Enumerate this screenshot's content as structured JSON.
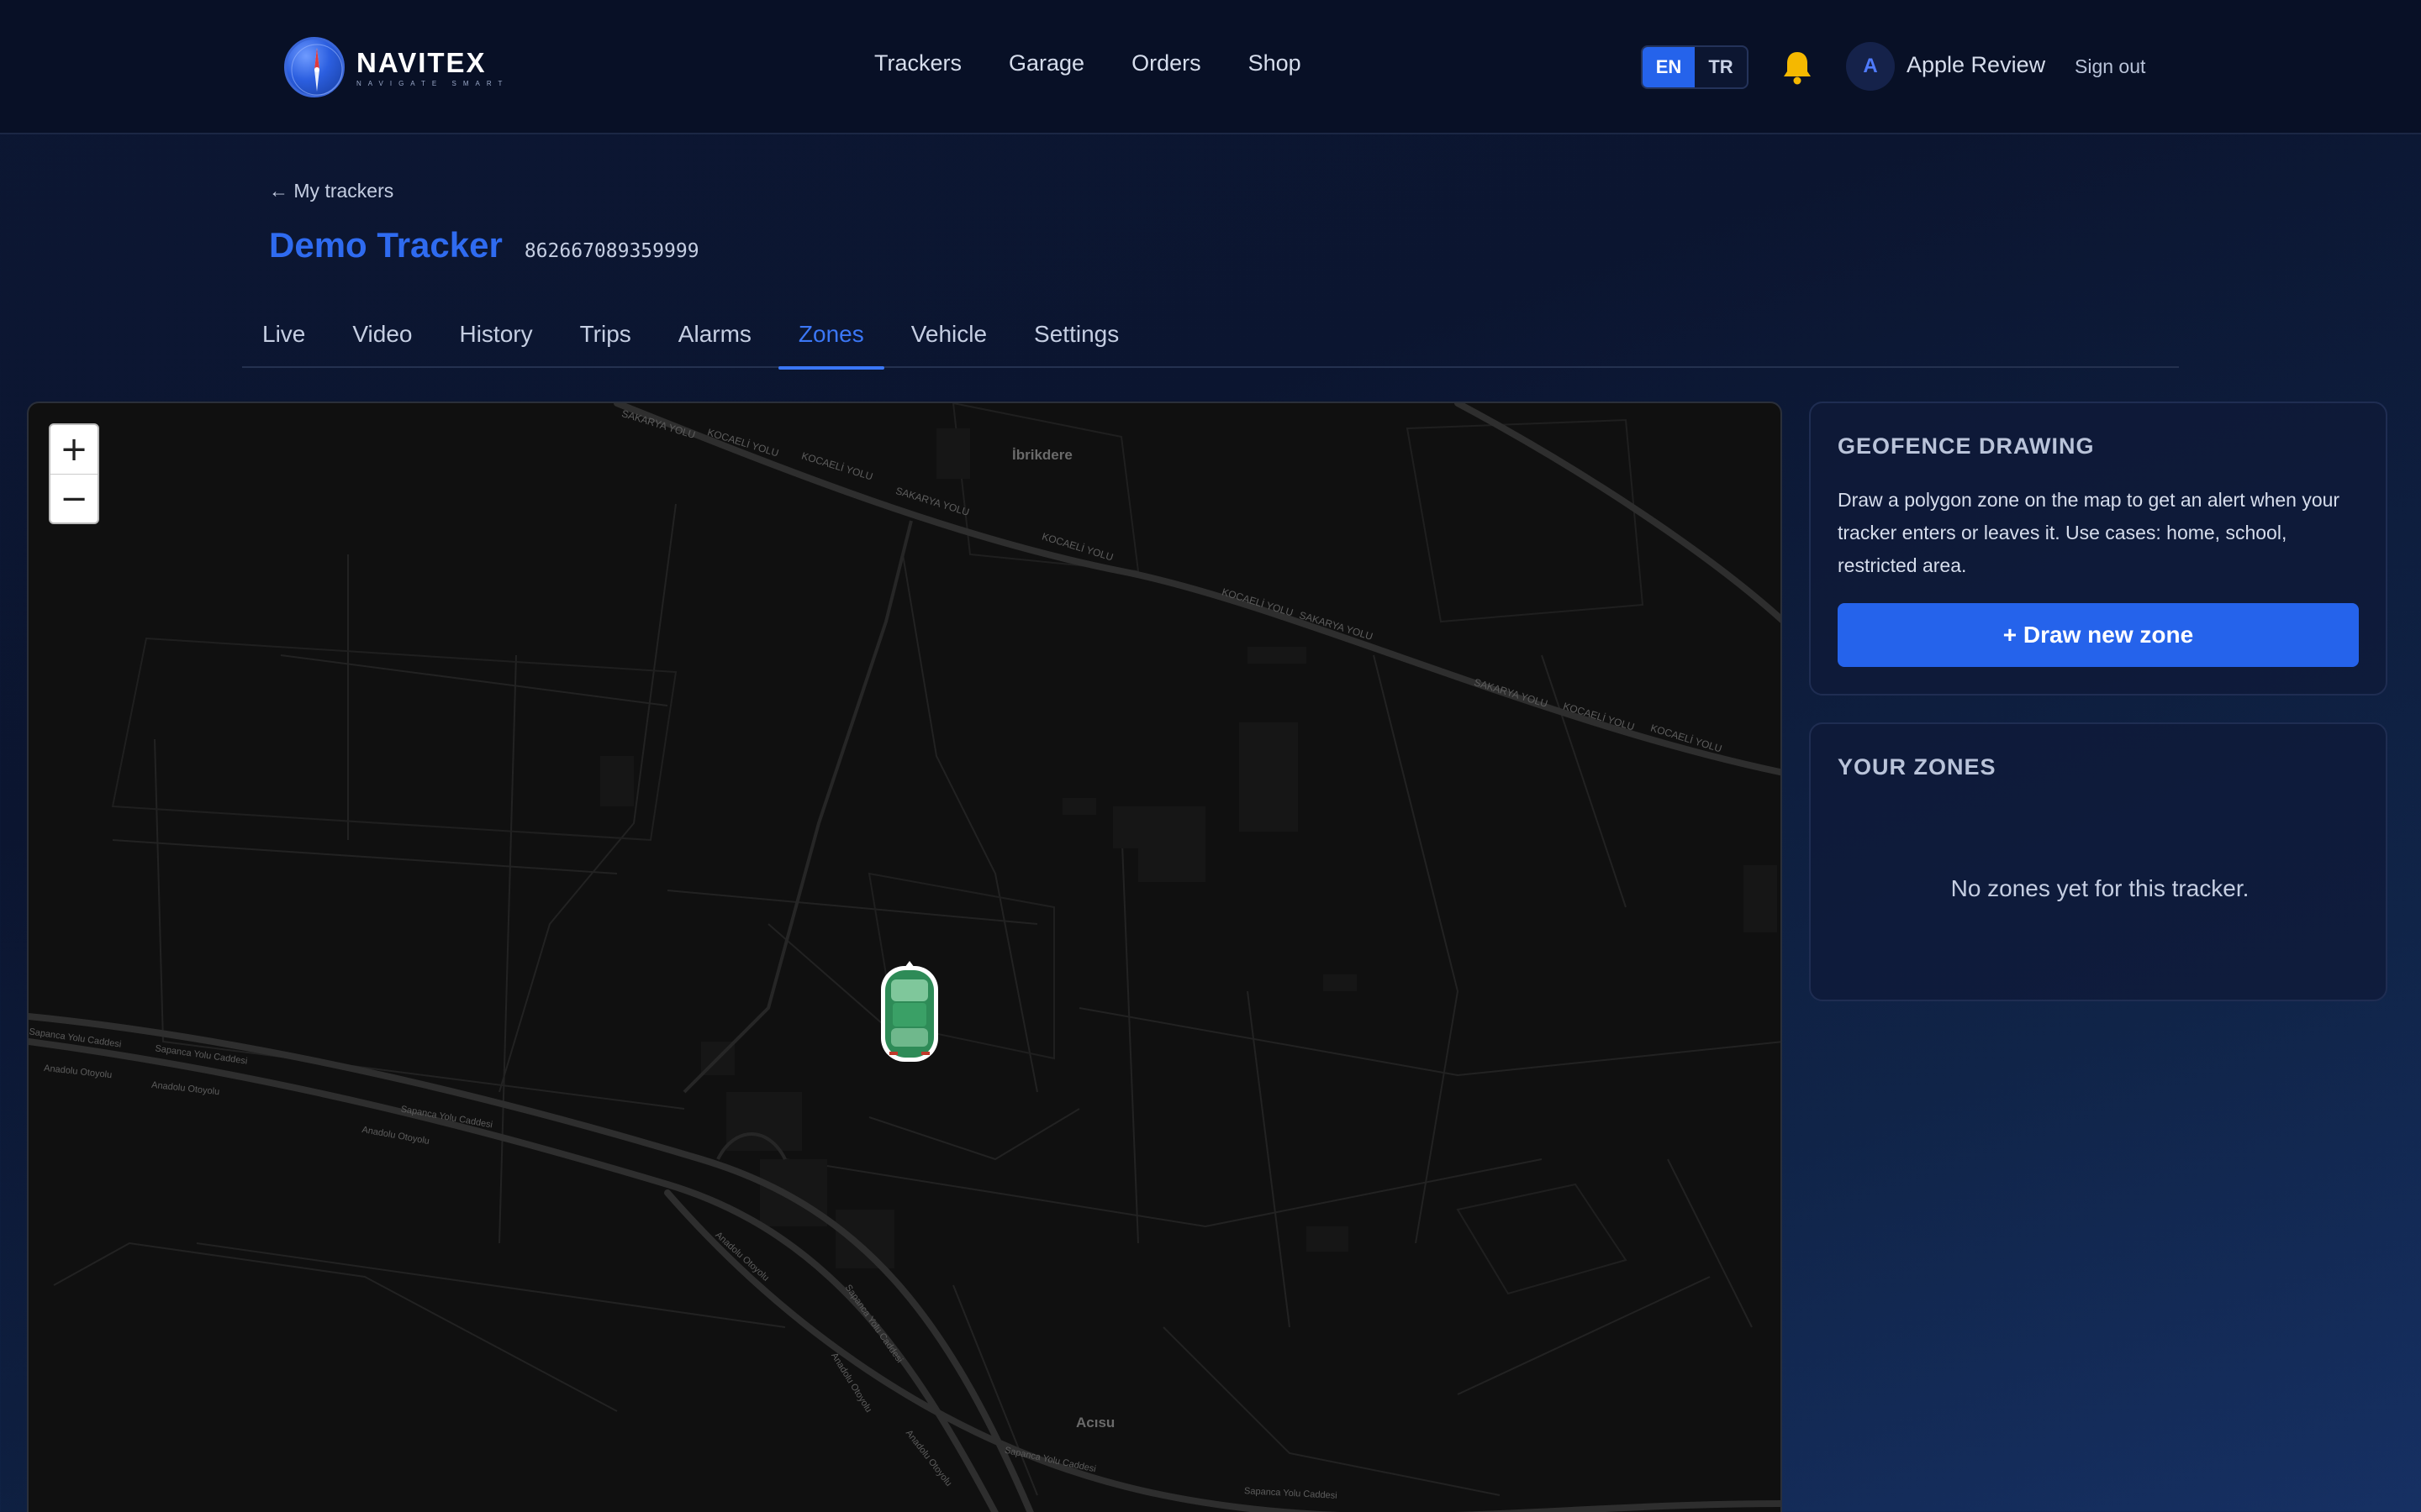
{
  "header": {
    "brand": "NAVITEX",
    "tagline": "NAVIGATE SMART",
    "nav": [
      "Trackers",
      "Garage",
      "Orders",
      "Shop"
    ],
    "lang": {
      "en": "EN",
      "tr": "TR",
      "selected": "EN"
    },
    "avatar_initial": "A",
    "user_name": "Apple Review",
    "sign_out": "Sign out"
  },
  "page": {
    "back_label": "My trackers",
    "title": "Demo Tracker",
    "imei": "862667089359999",
    "tabs": [
      "Live",
      "Video",
      "History",
      "Trips",
      "Alarms",
      "Zones",
      "Vehicle",
      "Settings"
    ],
    "active_tab": "Zones"
  },
  "map": {
    "zoom_in": "+",
    "zoom_out": "−",
    "places": [
      "İbrikdere",
      "Acısu"
    ],
    "roads": {
      "north": [
        "SAKARYA YOLU",
        "KOCAELİ YOLU",
        "KOCAELİ YOLU",
        "SAKARYA YOLU",
        "KOCAELİ YOLU",
        "KOCAELİ YOLU",
        "SAKARYA YOLU",
        "SAKARYA YOLU",
        "KOCAELİ YOLU",
        "KOCAELİ YOLU"
      ],
      "south": [
        "Sapanca Yolu Caddesi",
        "Sapanca Yolu Caddesi",
        "Anadolu Otoyolu",
        "Anadolu Otoyolu",
        "Sapanca Yolu Caddesi",
        "Anadolu Otoyolu",
        "Anadolu Otoyolu",
        "Sapanca Yolu Caddesi",
        "Anadolu Otoyolu",
        "Anadolu Otoyolu",
        "Sapanca Yolu Caddesi",
        "Sapanca Yolu Caddesi"
      ]
    },
    "marker": "car-marker"
  },
  "geofence": {
    "heading": "GEOFENCE DRAWING",
    "description": "Draw a polygon zone on the map to get an alert when your tracker enters or leaves it. Use cases: home, school, restricted area.",
    "button": "+ Draw new zone"
  },
  "zones": {
    "heading": "YOUR ZONES",
    "empty": "No zones yet for this tracker."
  },
  "colors": {
    "accent": "#2563eb",
    "title": "#2f6bf0",
    "bell": "#f5b800",
    "car": "#2e8b57"
  },
  "icons": {
    "back": "arrow-left-icon",
    "bell": "bell-icon",
    "logo": "compass-globe-icon"
  }
}
